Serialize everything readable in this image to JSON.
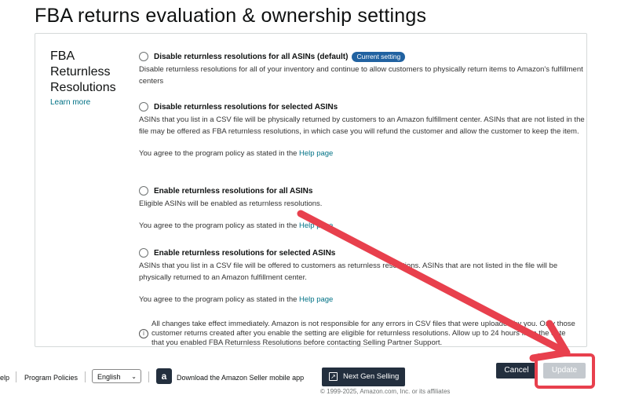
{
  "page": {
    "title": "FBA returns evaluation & ownership settings"
  },
  "sidebar": {
    "heading": "FBA Returnless Resolutions",
    "learn_more": "Learn more"
  },
  "options": [
    {
      "label": "Disable returnless resolutions for all ASINs (default)",
      "badge": "Current setting",
      "description": "Disable returnless resolutions for all of your inventory and continue to allow customers to physically return items to Amazon's fulfillment centers"
    },
    {
      "label": "Disable returnless resolutions for selected ASINs",
      "description": "ASINs that you list in a CSV file will be physically returned by customers to an Amazon fulfillment center. ASINs that are not listed in the file may be offered as FBA returnless resolutions, in which case you will refund the customer and allow the customer to keep the item.",
      "agree_prefix": "You agree to the program policy as stated in the",
      "agree_link": "Help page"
    },
    {
      "label": "Enable returnless resolutions for all ASINs",
      "description": "Eligible ASINs will be enabled as returnless resolutions.",
      "agree_prefix": "You agree to the program policy as stated in the",
      "agree_link": "Help page"
    },
    {
      "label": "Enable returnless resolutions for selected ASINs",
      "description": "ASINs that you list in a CSV file will be offered to customers as returnless resolutions. ASINs that are not listed in the file will be physically returned to an Amazon fulfillment center.",
      "agree_prefix": "You agree to the program policy as stated in the",
      "agree_link": "Help page"
    }
  ],
  "notice": "All changes take effect immediately. Amazon is not responsible for any errors in CSV files that were uploaded by you. Only those customer returns created after you enable the setting are eligible for returnless resolutions. Allow up to 24 hours from the date that you enabled FBA Returnless Resolutions before contacting Selling Partner Support.",
  "footer": {
    "help": "elp",
    "program_policies": "Program Policies",
    "language": "English",
    "app_icon": "a",
    "download_app": "Download the Amazon Seller mobile app",
    "next_gen": "Next Gen Selling",
    "next_gen_icon": "↗",
    "copyright": "© 1999-2025, Amazon.com, Inc. or its affiliates"
  },
  "actions": {
    "cancel": "Cancel",
    "update": "Update"
  },
  "icons": {
    "info": "i",
    "chevron": "⌄"
  },
  "colors": {
    "link": "#007185",
    "badge": "#2162a1",
    "dark_button": "#232f3e",
    "disabled_button": "#c4c9ce",
    "annotation": "#e8404d"
  }
}
